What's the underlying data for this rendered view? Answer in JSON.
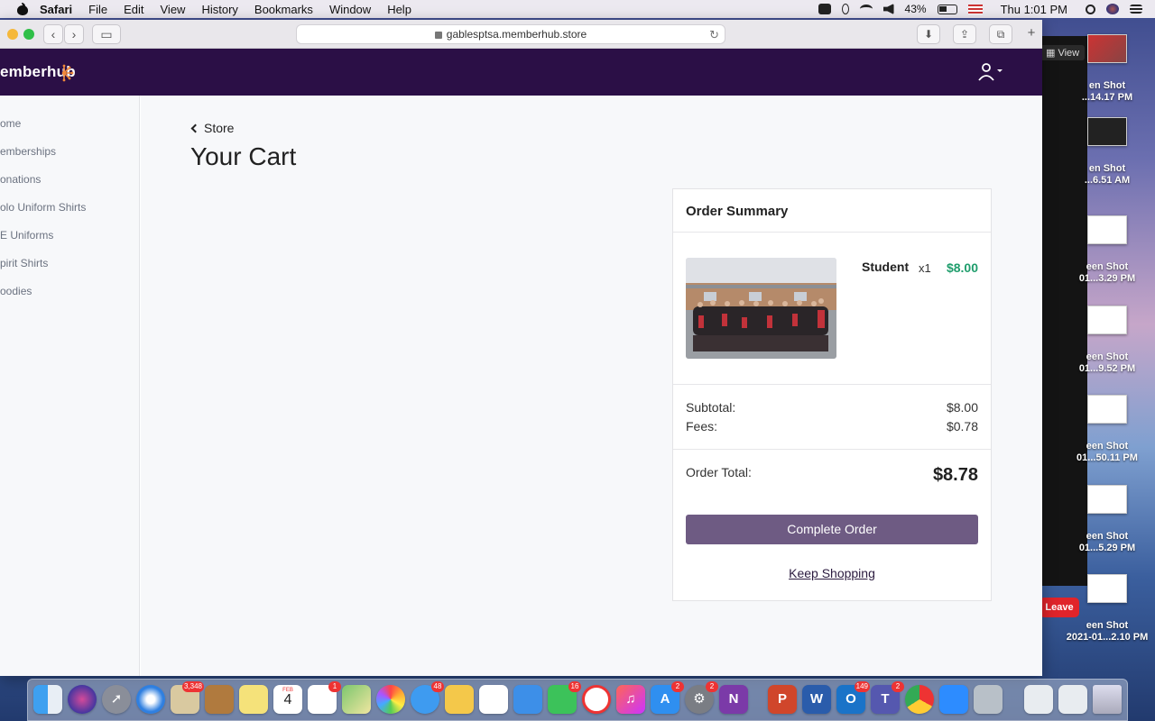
{
  "menubar": {
    "app_name": "Safari",
    "menus": [
      "File",
      "Edit",
      "View",
      "History",
      "Bookmarks",
      "Window",
      "Help"
    ],
    "battery": "43%",
    "clock": "Thu 1:01 PM"
  },
  "browser": {
    "url": "gablesptsa.memberhub.store"
  },
  "site": {
    "logo": "emberhub",
    "sidebar": [
      {
        "label": "ome"
      },
      {
        "label": "emberships"
      },
      {
        "label": "onations"
      },
      {
        "label": "olo Uniform Shirts"
      },
      {
        "label": "E Uniforms"
      },
      {
        "label": "pirit Shirts"
      },
      {
        "label": "oodies"
      }
    ],
    "back_link": "Store",
    "page_title": "Your Cart"
  },
  "order": {
    "header": "Order Summary",
    "item": {
      "name": "Student",
      "qty": "x1",
      "price": "$8.00"
    },
    "subtotal_label": "Subtotal:",
    "subtotal_value": "$8.00",
    "fees_label": "Fees:",
    "fees_value": "$0.78",
    "total_label": "Order Total:",
    "total_value": "$8.78",
    "complete_label": "Complete Order",
    "keep_label": "Keep Shopping",
    "price_color": "#1f9d6c",
    "button_color": "#6e5b83"
  },
  "zoom": {
    "view_label": "View",
    "leave_label": "Leave"
  },
  "desktop": [
    {
      "line1": "en Shot",
      "line2": "...14.17 PM"
    },
    {
      "line1": "en Shot",
      "line2": "...6.51 AM"
    },
    {
      "line1": "een Shot",
      "line2": "01...3.29 PM"
    },
    {
      "line1": "een Shot",
      "line2": "01...9.52 PM"
    },
    {
      "line1": "een Shot",
      "line2": "01...50.11 PM"
    },
    {
      "line1": "een Shot",
      "line2": "01...5.29 PM"
    },
    {
      "line1": "een Shot",
      "line2": "2021-01...2.10 PM"
    }
  ],
  "dock": {
    "badges": {
      "mail": "3,348",
      "reminders": "1",
      "messages": "48",
      "facetime": "16",
      "appstore": "2",
      "prefs": "2",
      "outlook": "149",
      "teams": "2"
    },
    "calendar_month": "FEB",
    "calendar_day": "4"
  }
}
